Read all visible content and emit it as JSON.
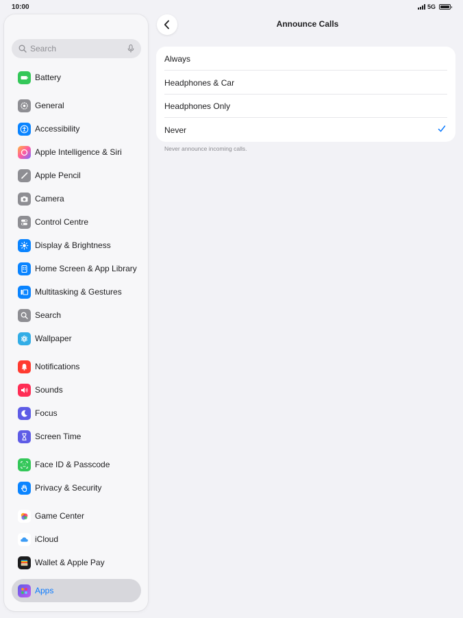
{
  "status_bar": {
    "time": "10:00",
    "network": "5G"
  },
  "sidebar": {
    "search_placeholder": "Search",
    "items": [
      {
        "label": "Battery",
        "icon": "battery-icon",
        "color": "#34c759"
      },
      {
        "label": "General",
        "icon": "gear-icon",
        "color": "#8e8e93"
      },
      {
        "label": "Accessibility",
        "icon": "accessibility-icon",
        "color": "#0a84ff"
      },
      {
        "label": "Apple Intelligence & Siri",
        "icon": "siri-icon",
        "color": "#ff7ab0"
      },
      {
        "label": "Apple Pencil",
        "icon": "pencil-icon",
        "color": "#8e8e93"
      },
      {
        "label": "Camera",
        "icon": "camera-icon",
        "color": "#8e8e93"
      },
      {
        "label": "Control Centre",
        "icon": "toggles-icon",
        "color": "#8e8e93"
      },
      {
        "label": "Display & Brightness",
        "icon": "sun-icon",
        "color": "#0a84ff"
      },
      {
        "label": "Home Screen & App Library",
        "icon": "home-screen-icon",
        "color": "#0a84ff"
      },
      {
        "label": "Multitasking & Gestures",
        "icon": "multitasking-icon",
        "color": "#0a84ff"
      },
      {
        "label": "Search",
        "icon": "magnifier-icon",
        "color": "#8e8e93"
      },
      {
        "label": "Wallpaper",
        "icon": "flower-icon",
        "color": "#32ade6"
      },
      {
        "label": "Notifications",
        "icon": "bell-icon",
        "color": "#ff3b30"
      },
      {
        "label": "Sounds",
        "icon": "speaker-icon",
        "color": "#ff2d55"
      },
      {
        "label": "Focus",
        "icon": "moon-icon",
        "color": "#5e5ce6"
      },
      {
        "label": "Screen Time",
        "icon": "hourglass-icon",
        "color": "#5e5ce6"
      },
      {
        "label": "Face ID & Passcode",
        "icon": "face-id-icon",
        "color": "#34c759"
      },
      {
        "label": "Privacy & Security",
        "icon": "hand-icon",
        "color": "#0a84ff"
      },
      {
        "label": "Game Center",
        "icon": "game-center-icon",
        "color": "#ff9500"
      },
      {
        "label": "iCloud",
        "icon": "cloud-icon",
        "color": "#ffffff"
      },
      {
        "label": "Wallet & Apple Pay",
        "icon": "wallet-icon",
        "color": "#1c1c1e"
      },
      {
        "label": "Apps",
        "icon": "apps-grid-icon",
        "color": "#5e5ce6",
        "selected": true
      }
    ]
  },
  "main": {
    "title": "Announce Calls",
    "options": [
      {
        "label": "Always",
        "checked": false
      },
      {
        "label": "Headphones & Car",
        "checked": false
      },
      {
        "label": "Headphones Only",
        "checked": false
      },
      {
        "label": "Never",
        "checked": true
      }
    ],
    "footnote": "Never announce incoming calls.",
    "accent_color": "#0a7aff"
  }
}
